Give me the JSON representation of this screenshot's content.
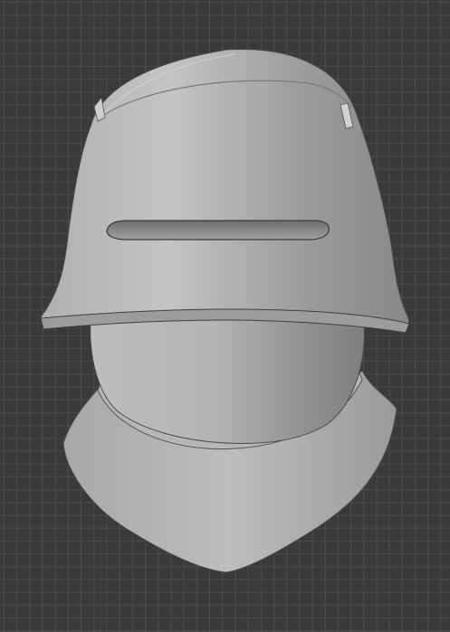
{
  "viewport": {
    "kind": "3d-viewport",
    "background_color": "#3a3a3a",
    "grid_color": "#5a5a5a",
    "grid_visible": true
  },
  "model": {
    "subject": "sallet-helmet-with-bevor",
    "shading": "solid-gray",
    "base_color": "#a9a9a9",
    "parts": [
      "skull-dome",
      "visor-brim",
      "eye-slit",
      "inner-dome",
      "bevor-collar"
    ]
  }
}
